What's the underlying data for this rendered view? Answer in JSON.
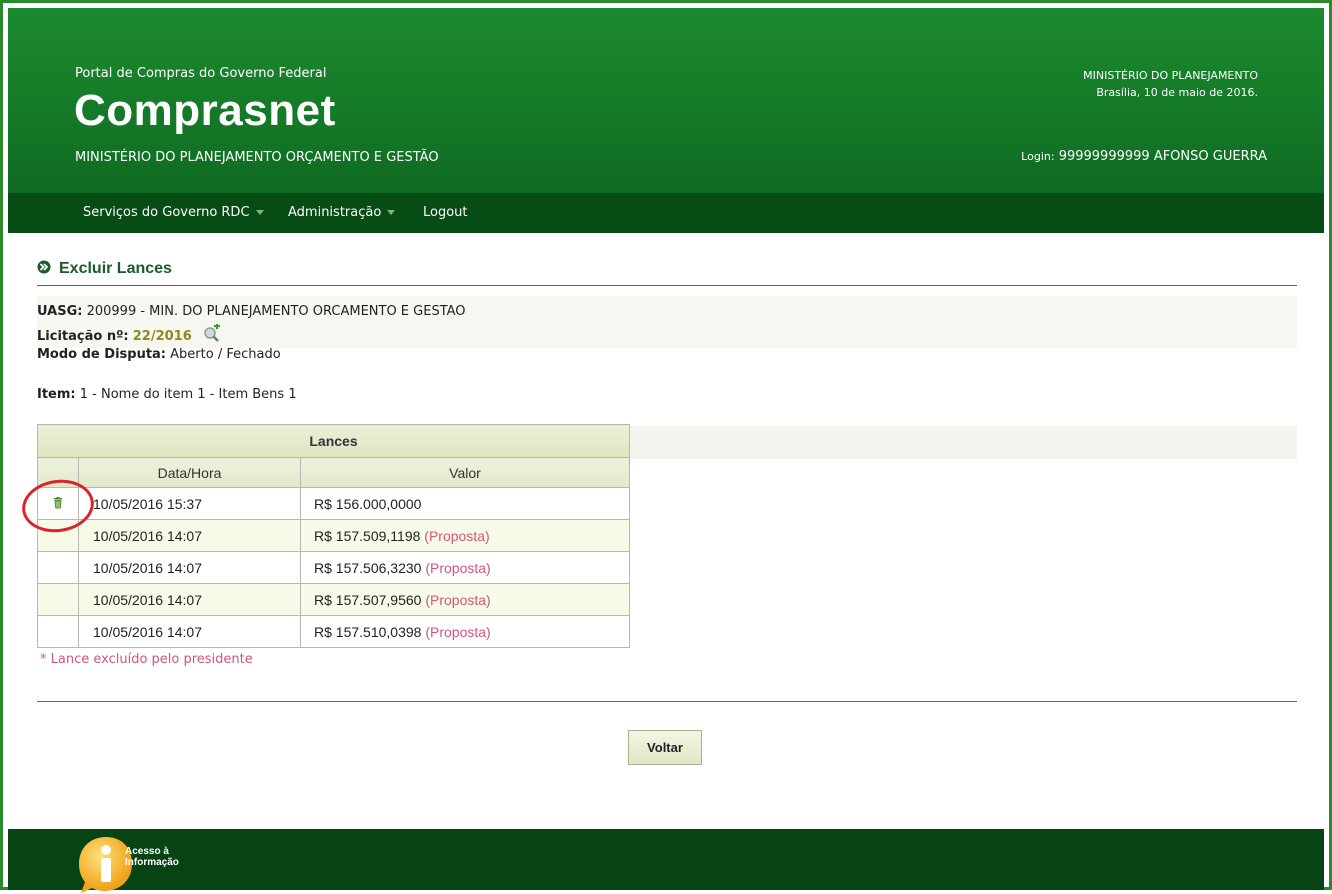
{
  "header": {
    "portal": "Portal de Compras do Governo Federal",
    "brand": "Comprasnet",
    "ministry": "MINISTÉRIO DO PLANEJAMENTO ORÇAMENTO E GESTÃO",
    "right_ministry": "MINISTÉRIO DO PLANEJAMENTO",
    "date": "Brasília, 10 de maio de 2016.",
    "login_label": "Login:",
    "login_user": "99999999999 AFONSO GUERRA"
  },
  "nav": {
    "items": [
      {
        "label": "Serviços do Governo RDC",
        "has_menu": true
      },
      {
        "label": "Administração",
        "has_menu": true
      },
      {
        "label": "Logout",
        "has_menu": false
      }
    ]
  },
  "page": {
    "title": "Excluir Lances",
    "uasg_label": "UASG:",
    "uasg_value": "200999 - MIN. DO PLANEJAMENTO ORCAMENTO E GESTAO",
    "licitacao_label": "Licitação nº:",
    "licitacao_value": "22/2016",
    "modo_label": "Modo de Disputa:",
    "modo_value": "Aberto / Fechado",
    "item_label": "Item:",
    "item_value": "1 - Nome do item 1 - Item Bens 1"
  },
  "table": {
    "caption": "Lances",
    "headers": [
      "Data/Hora",
      "Valor"
    ],
    "rows": [
      {
        "datetime": "10/05/2016 15:37",
        "value": "R$ 156.000,0000",
        "tag": "",
        "deletable": true
      },
      {
        "datetime": "10/05/2016 14:07",
        "value": "R$ 157.509,1198",
        "tag": "(Proposta)",
        "deletable": false
      },
      {
        "datetime": "10/05/2016 14:07",
        "value": "R$ 157.506,3230",
        "tag": "(Proposta)",
        "deletable": false
      },
      {
        "datetime": "10/05/2016 14:07",
        "value": "R$ 157.507,9560",
        "tag": "(Proposta)",
        "deletable": false
      },
      {
        "datetime": "10/05/2016 14:07",
        "value": "R$ 157.510,0398",
        "tag": "(Proposta)",
        "deletable": false
      }
    ]
  },
  "note": "* Lance excluído pelo presidente",
  "button": {
    "label": "Voltar"
  },
  "footer": {
    "acesso_line1": "Acesso à",
    "acesso_line2": "Informação"
  },
  "colors": {
    "header_green": "#157a28",
    "nav_green": "#074b15",
    "footer_green": "#064414",
    "accent_pink": "#d0567e",
    "annotation_red": "#d8242b"
  }
}
